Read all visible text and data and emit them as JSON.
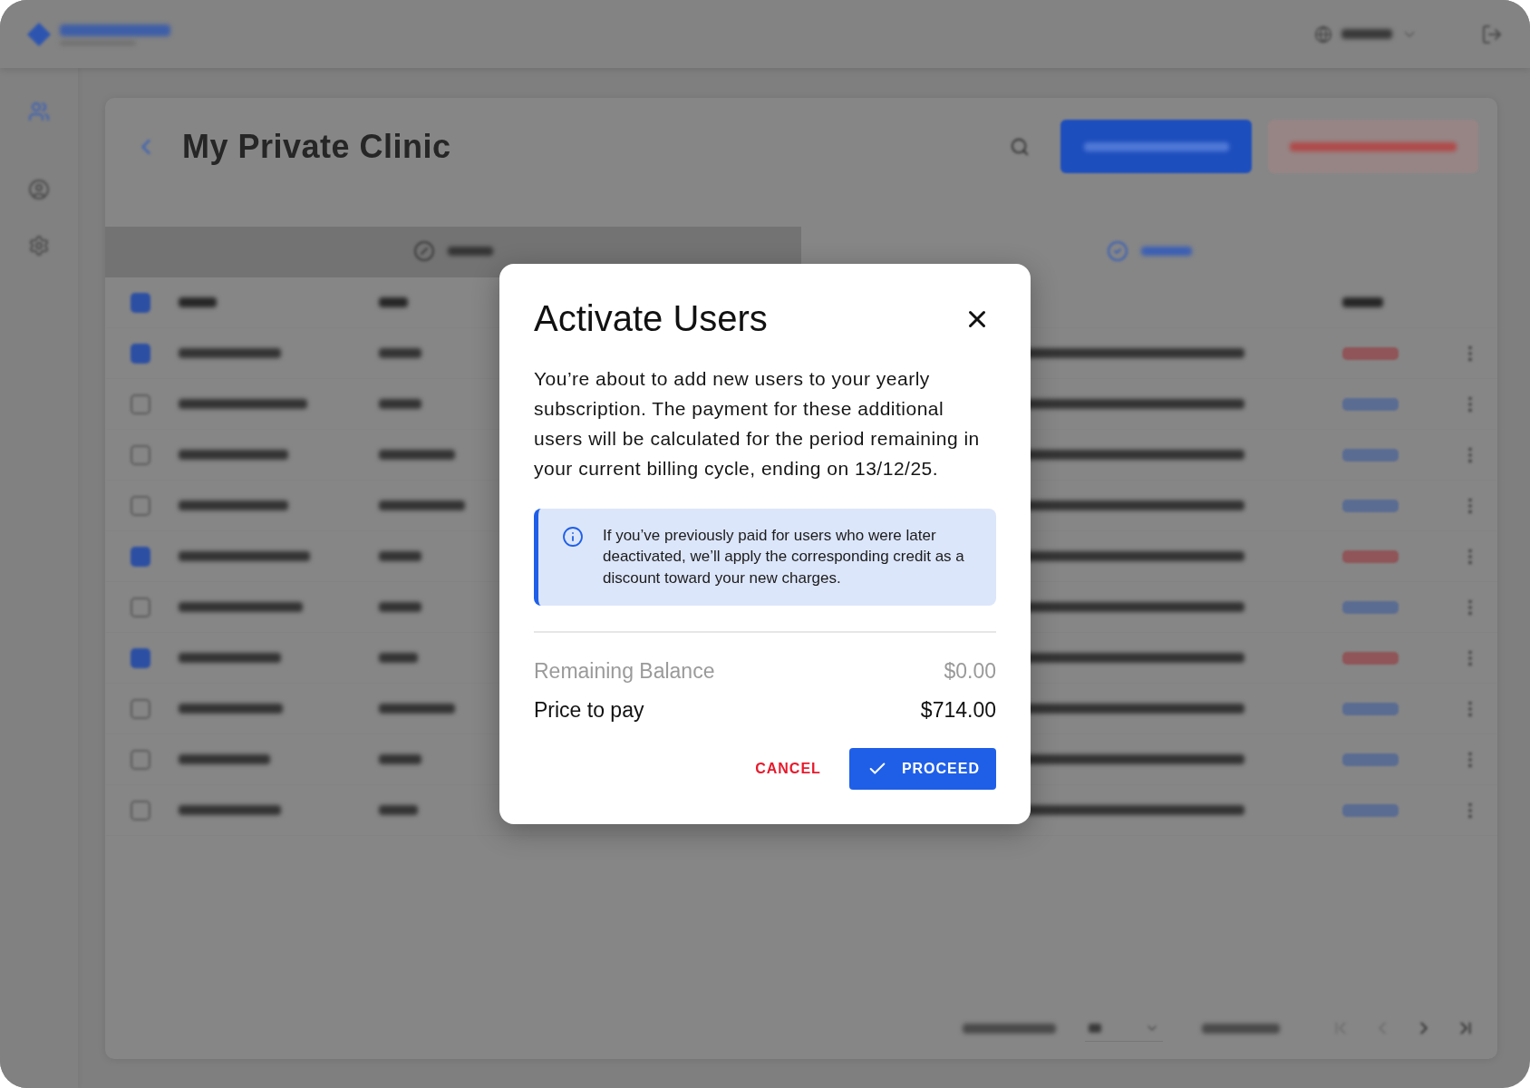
{
  "background_page": {
    "title": "My Private Clinic",
    "tabs": [
      {
        "selected": false
      },
      {
        "selected": true
      }
    ],
    "table": {
      "all_checked": true,
      "rows": [
        {
          "checked": true,
          "color": "#8f5558"
        },
        {
          "checked": false,
          "color": "#5a6c92"
        },
        {
          "checked": false,
          "color": "#5a6c92"
        },
        {
          "checked": false,
          "color": "#5a6c92"
        },
        {
          "checked": true,
          "color": "#8f5558"
        },
        {
          "checked": false,
          "color": "#5a6c92"
        },
        {
          "checked": true,
          "color": "#8f5558"
        },
        {
          "checked": false,
          "color": "#5a6c92"
        },
        {
          "checked": false,
          "color": "#5a6c92"
        },
        {
          "checked": false,
          "color": "#5a6c92"
        }
      ]
    }
  },
  "dialog": {
    "title": "Activate Users",
    "message": "You’re about to add new users to your yearly subscription. The payment for these additional users will be calculated for the period remaining in your current billing cycle, ending on 13/12/25.",
    "info_note": "If you’ve previously paid for users who were later deactivated, we’ll apply the corresponding credit as a discount toward your new charges.",
    "summary": [
      {
        "label": "Remaining Balance",
        "value": "$0.00",
        "muted": true
      },
      {
        "label": "Price to pay",
        "value": "$714.00",
        "muted": false
      }
    ],
    "buttons": [
      {
        "kind": "text",
        "label": "CANCEL"
      },
      {
        "kind": "primary",
        "label": "PROCEED"
      }
    ]
  }
}
